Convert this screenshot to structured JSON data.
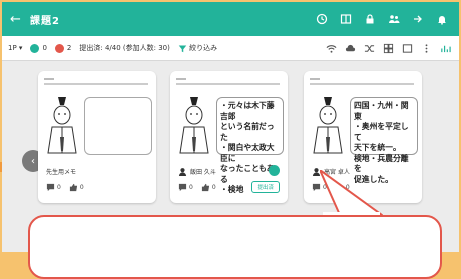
{
  "header": {
    "back_glyph": "←",
    "title": "課題2",
    "icons": [
      "clock-icon",
      "layout-icon",
      "lock-icon",
      "people-icon",
      "share-icon",
      "bell-icon"
    ]
  },
  "toolbar": {
    "page_label": "1P",
    "count_green": "0",
    "count_red": "2",
    "submission_status": "提出済: 4/40 (参加人数: 30)",
    "filter_label": "絞り込み",
    "right_icons": [
      "wifi-icon",
      "cloud-icon",
      "shuffle-icon",
      "grid-icon",
      "window-icon",
      "more-icon",
      "chart-icon"
    ]
  },
  "cards": [
    {
      "note_text": "",
      "author": "先生用メモ",
      "comments": "0",
      "likes": "0",
      "badge": "",
      "checked": false
    },
    {
      "note_text": "・元々は木下藤吉郎\nという名前だった\n・関白や太政大臣に\nなったこともある\n・検地",
      "author": "飯田 久斗",
      "comments": "0",
      "likes": "0",
      "badge": "提出済",
      "checked": true
    },
    {
      "note_text": "四国・九州・関東\n・奥州を平定して\n天下を統一。\n検地・兵農分離を\n促進した。",
      "author": "高宮 卓人",
      "comments": "0",
      "likes": "0",
      "badge": "",
      "checked": false
    }
  ],
  "pager": {
    "prev": "‹",
    "current": "1",
    "next": "›"
  },
  "colors": {
    "accent": "#22b39a",
    "callout_border": "#e3574b",
    "background_outer": "#f6c26e"
  }
}
